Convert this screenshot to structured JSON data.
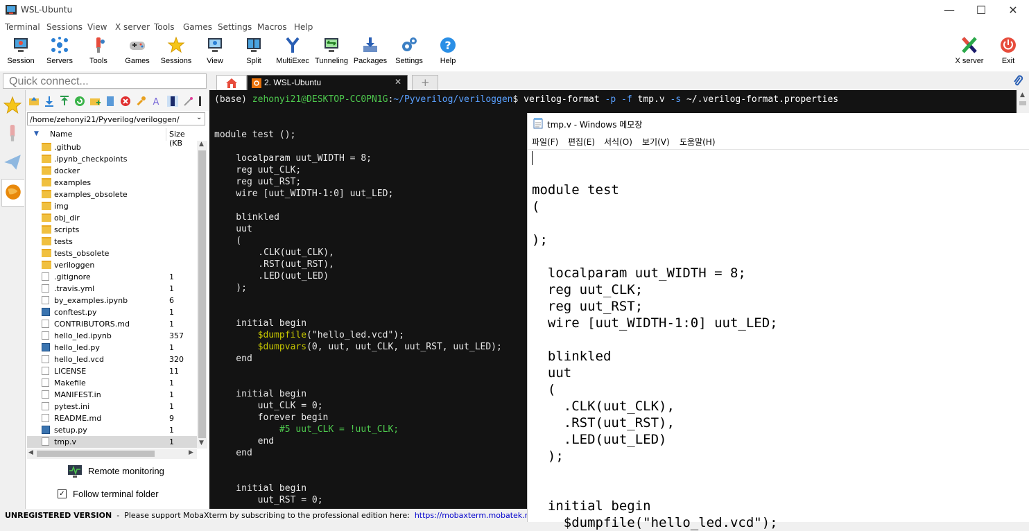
{
  "window": {
    "title": "WSL-Ubuntu"
  },
  "menu": [
    "Terminal",
    "Sessions",
    "View",
    "X server",
    "Tools",
    "Games",
    "Settings",
    "Macros",
    "Help"
  ],
  "toolbar": {
    "session": "Session",
    "servers": "Servers",
    "tools": "Tools",
    "games": "Games",
    "sessions": "Sessions",
    "view": "View",
    "split": "Split",
    "multiexec": "MultiExec",
    "tunneling": "Tunneling",
    "packages": "Packages",
    "settings": "Settings",
    "help": "Help",
    "xserver": "X server",
    "exit": "Exit"
  },
  "quick_connect": {
    "placeholder": "Quick connect..."
  },
  "tabs": {
    "active": "2. WSL-Ubuntu"
  },
  "browser": {
    "path": "/home/zehonyi21/Pyverilog/veriloggen/",
    "col_name": "Name",
    "col_size": "Size (KB",
    "files": [
      {
        "name": ".github",
        "size": "",
        "type": "folder"
      },
      {
        "name": ".ipynb_checkpoints",
        "size": "",
        "type": "folder"
      },
      {
        "name": "docker",
        "size": "",
        "type": "folder"
      },
      {
        "name": "examples",
        "size": "",
        "type": "folder"
      },
      {
        "name": "examples_obsolete",
        "size": "",
        "type": "folder"
      },
      {
        "name": "img",
        "size": "",
        "type": "folder"
      },
      {
        "name": "obj_dir",
        "size": "",
        "type": "folder"
      },
      {
        "name": "scripts",
        "size": "",
        "type": "folder"
      },
      {
        "name": "tests",
        "size": "",
        "type": "folder"
      },
      {
        "name": "tests_obsolete",
        "size": "",
        "type": "folder"
      },
      {
        "name": "veriloggen",
        "size": "",
        "type": "folder"
      },
      {
        "name": ".gitignore",
        "size": "1",
        "type": "file"
      },
      {
        "name": ".travis.yml",
        "size": "1",
        "type": "file"
      },
      {
        "name": "by_examples.ipynb",
        "size": "6",
        "type": "file"
      },
      {
        "name": "conftest.py",
        "size": "1",
        "type": "py"
      },
      {
        "name": "CONTRIBUTORS.md",
        "size": "1",
        "type": "file"
      },
      {
        "name": "hello_led.ipynb",
        "size": "357",
        "type": "file"
      },
      {
        "name": "hello_led.py",
        "size": "1",
        "type": "py"
      },
      {
        "name": "hello_led.vcd",
        "size": "320",
        "type": "file"
      },
      {
        "name": "LICENSE",
        "size": "11",
        "type": "file"
      },
      {
        "name": "Makefile",
        "size": "1",
        "type": "file"
      },
      {
        "name": "MANIFEST.in",
        "size": "1",
        "type": "file"
      },
      {
        "name": "pytest.ini",
        "size": "1",
        "type": "file"
      },
      {
        "name": "README.md",
        "size": "9",
        "type": "file"
      },
      {
        "name": "setup.py",
        "size": "1",
        "type": "py"
      },
      {
        "name": "tmp.v",
        "size": "1",
        "type": "file",
        "selected": true
      }
    ],
    "remote_monitoring": "Remote monitoring",
    "follow_terminal": "Follow terminal folder"
  },
  "terminal": {
    "prompt_base": "(base) ",
    "prompt_user": "zehonyi21@DESKTOP-CC0PN1G",
    "prompt_sep": ":",
    "prompt_path": "~/Pyverilog/veriloggen",
    "prompt_end": "$ ",
    "cmd": "verilog-format",
    "cmd_args": " -p -f ",
    "cmd_file": "tmp.v",
    "cmd_s": " -s ",
    "cmd_props": "~/.verilog-format.properties",
    "lines": [
      "module test ();",
      "    localparam uut_WIDTH = 8;",
      "    reg uut_CLK;",
      "    reg uut_RST;",
      "    wire [uut_WIDTH-1:0] uut_LED;",
      "    blinkled",
      "    uut",
      "    (",
      "    .CLK(uut_CLK),",
      "    .RST(uut_RST),",
      "    .LED(uut_LED)",
      "    );",
      "    initial begin",
      "        $dumpfile",
      "(\"hello_led.vcd\");",
      "        $dumpvars",
      "(0, uut, uut_CLK, uut_RST, uut_LED);",
      "    end",
      "    initial begin",
      "        uut_CLK = 0;",
      "        forever begin",
      "            #5 uut_CLK = !uut_CLK;",
      "        end",
      "    end",
      "    initial begin",
      "        uut_RST = 0;"
    ]
  },
  "notepad": {
    "title": "tmp.v - Windows 메모장",
    "menu": [
      "파일(F)",
      "편집(E)",
      "서식(O)",
      "보기(V)",
      "도움말(H)"
    ],
    "lines": [
      "module test",
      "(",
      ");",
      "  localparam uut_WIDTH = 8;",
      "  reg uut_CLK;",
      "  reg uut_RST;",
      "  wire [uut_WIDTH-1:0] uut_LED;",
      "  blinkled",
      "  uut",
      "  (",
      "    .CLK(uut_CLK),",
      "    .RST(uut_RST),",
      "    .LED(uut_LED)",
      "  );",
      "  initial begin",
      "    $dumpfile(\"hello_led.vcd\");"
    ]
  },
  "status": {
    "label": "UNREGISTERED VERSION",
    "text": "  -  Please support MobaXterm by subscribing to the professional edition here:  ",
    "link": "https://mobaxterm.mobatek.net"
  },
  "colors": {
    "prompt_green": "#4ec94e",
    "path_blue": "#5aa0ff",
    "terminal_bg": "#131313",
    "dollar_yellow": "#c8c800",
    "link_blue": "#0000cc"
  }
}
